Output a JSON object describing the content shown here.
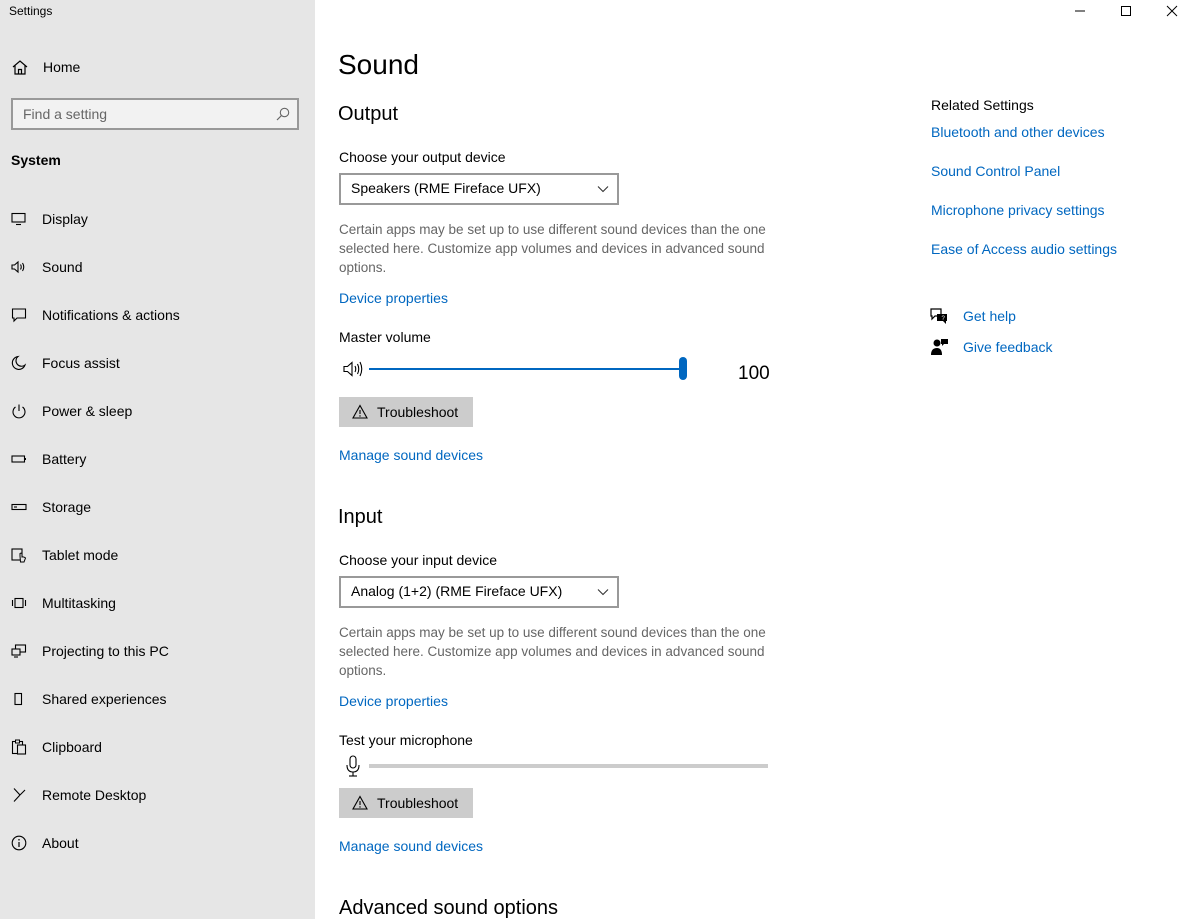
{
  "app": {
    "title": "Settings"
  },
  "window_controls": {
    "minimize": "minimize-icon",
    "maximize": "maximize-icon",
    "close": "close-icon"
  },
  "sidebar": {
    "home_label": "Home",
    "search_placeholder": "Find a setting",
    "section_title": "System",
    "items": [
      {
        "label": "Display",
        "icon": "display-icon"
      },
      {
        "label": "Sound",
        "icon": "speaker-icon"
      },
      {
        "label": "Notifications & actions",
        "icon": "notification-icon"
      },
      {
        "label": "Focus assist",
        "icon": "moon-icon"
      },
      {
        "label": "Power & sleep",
        "icon": "power-icon"
      },
      {
        "label": "Battery",
        "icon": "battery-icon"
      },
      {
        "label": "Storage",
        "icon": "storage-icon"
      },
      {
        "label": "Tablet mode",
        "icon": "tablet-icon"
      },
      {
        "label": "Multitasking",
        "icon": "multitasking-icon"
      },
      {
        "label": "Projecting to this PC",
        "icon": "projecting-icon"
      },
      {
        "label": "Shared experiences",
        "icon": "shared-experiences-icon"
      },
      {
        "label": "Clipboard",
        "icon": "clipboard-icon"
      },
      {
        "label": "Remote Desktop",
        "icon": "remote-desktop-icon"
      },
      {
        "label": "About",
        "icon": "info-icon"
      }
    ]
  },
  "main": {
    "title": "Sound",
    "output": {
      "heading": "Output",
      "device_label": "Choose your output device",
      "device_value": "Speakers (RME Fireface UFX)",
      "description": "Certain apps may be set up to use different sound devices than the one selected here. Customize app volumes and devices in advanced sound options.",
      "device_properties": "Device properties",
      "volume_label": "Master volume",
      "volume_value": "100",
      "volume_level": 1.0,
      "troubleshoot": "Troubleshoot",
      "manage": "Manage sound devices"
    },
    "input": {
      "heading": "Input",
      "device_label": "Choose your input device",
      "device_value": "Analog (1+2) (RME Fireface UFX)",
      "description": "Certain apps may be set up to use different sound devices than the one selected here. Customize app volumes and devices in advanced sound options.",
      "device_properties": "Device properties",
      "test_label": "Test your microphone",
      "mic_level": 0,
      "troubleshoot": "Troubleshoot",
      "manage": "Manage sound devices"
    },
    "advanced_heading": "Advanced sound options"
  },
  "related": {
    "title": "Related Settings",
    "links": [
      "Bluetooth and other devices",
      "Sound Control Panel",
      "Microphone privacy settings",
      "Ease of Access audio settings"
    ],
    "get_help": "Get help",
    "give_feedback": "Give feedback"
  },
  "colors": {
    "accent": "#0067c0",
    "sidebar_bg": "#e6e6e6",
    "button_bg": "#cccccc"
  }
}
